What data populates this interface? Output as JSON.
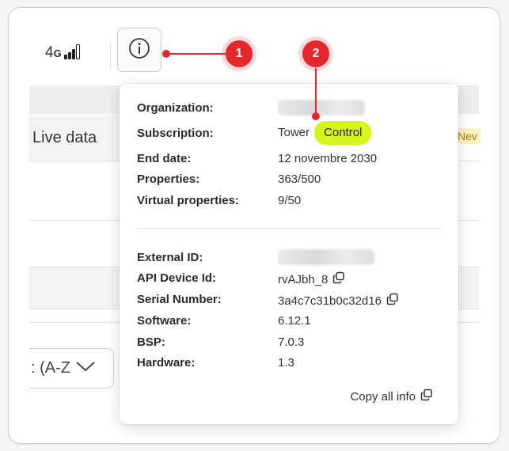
{
  "status": {
    "network_main": "4",
    "network_sub": "G",
    "signal_icon": "signal-bars-icon"
  },
  "background": {
    "tab_live": "Live data",
    "new_badge": "Nev",
    "sort_label": ": (A-Z"
  },
  "markers": {
    "one": "1",
    "two": "2"
  },
  "popover": {
    "group1": [
      {
        "label": "Organization:",
        "value": "",
        "blurred": true
      },
      {
        "label": "Subscription:",
        "value": "Tower",
        "badge": "Control"
      },
      {
        "label": "End date:",
        "value": "12 novembre 2030"
      },
      {
        "label": "Properties:",
        "value": "363/500"
      },
      {
        "label": "Virtual properties:",
        "value": "9/50"
      }
    ],
    "group2": [
      {
        "label": "External ID:",
        "value": "",
        "blurred": true
      },
      {
        "label": "API Device Id:",
        "value": "rvAJbh_8",
        "copy": true
      },
      {
        "label": "Serial Number:",
        "value": "3a4c7c31b0c32d16",
        "copy": true
      },
      {
        "label": "Software:",
        "value": "6.12.1"
      },
      {
        "label": "BSP:",
        "value": "7.0.3"
      },
      {
        "label": "Hardware:",
        "value": "1.3"
      }
    ],
    "copy_all": "Copy all info"
  },
  "colors": {
    "accent_marker": "#e5262d",
    "control_badge": "#d8f51b"
  }
}
